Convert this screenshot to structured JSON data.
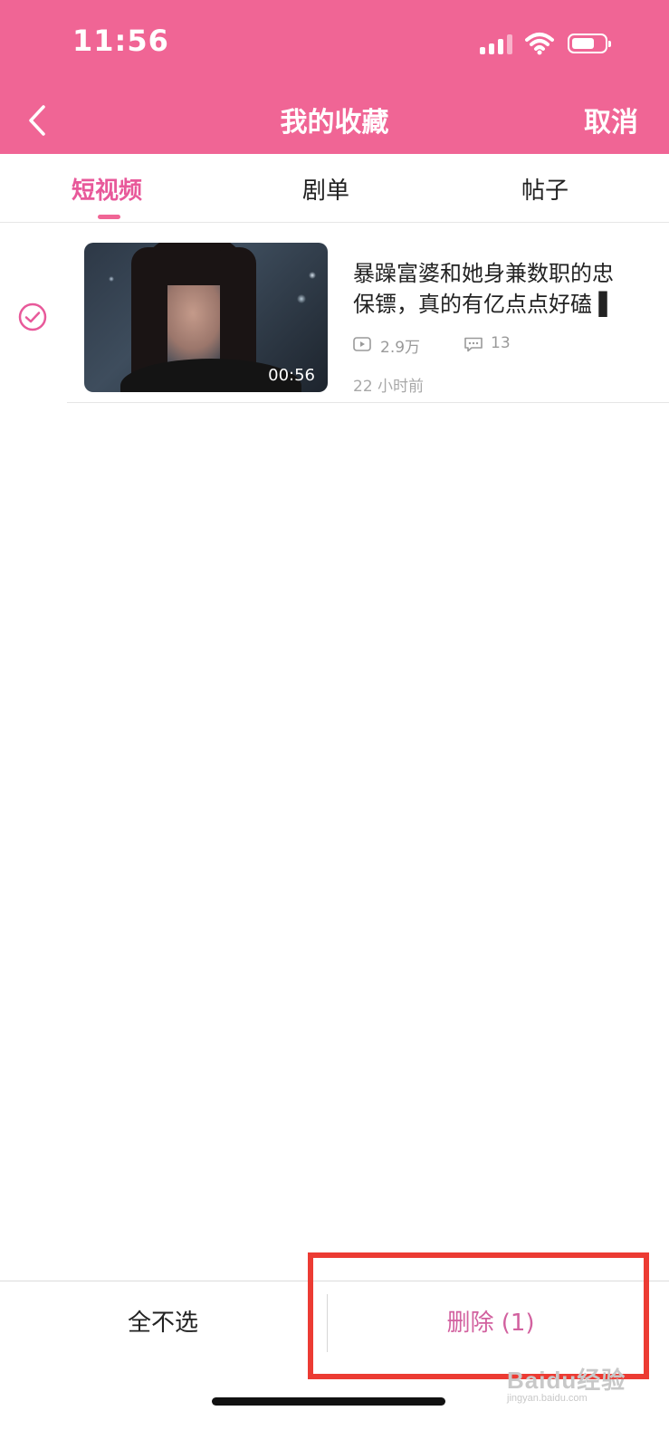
{
  "status_bar": {
    "time": "11:56"
  },
  "nav": {
    "title": "我的收藏",
    "cancel_label": "取消"
  },
  "tabs": [
    {
      "label": "短视频",
      "active": true
    },
    {
      "label": "剧单",
      "active": false
    },
    {
      "label": "帖子",
      "active": false
    }
  ],
  "items": [
    {
      "selected": true,
      "duration": "00:56",
      "title_lines": [
        "暴躁富婆和她身兼数职的忠",
        "保镖，真的有亿点点好磕 ▌"
      ],
      "views": "2.9万",
      "comments": "13",
      "time_ago": "22 小时前"
    }
  ],
  "bottom_bar": {
    "unselect_all_label": "全不选",
    "delete_label": "删除 (1)"
  },
  "watermark": {
    "main": "Baidu经验",
    "sub": "jingyan.baidu.com"
  },
  "colors": {
    "brand_pink": "#f06595",
    "accent_text": "#e8599a",
    "highlight_red": "#ec3b33"
  }
}
